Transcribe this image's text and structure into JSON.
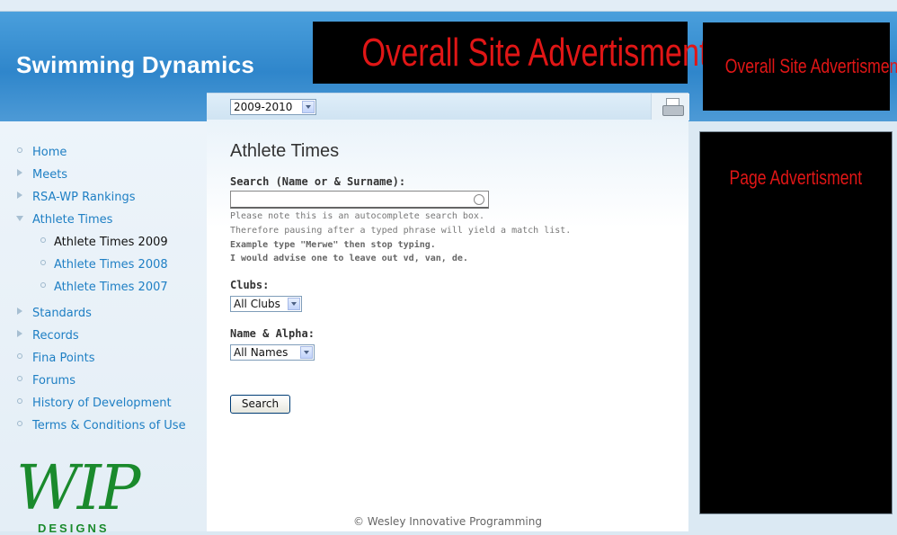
{
  "site": {
    "title": "Swimming Dynamics"
  },
  "ads": {
    "banner": "Overall Site Advertisment",
    "right_top": "Overall Site Advertisment",
    "page": "Page Advertisment"
  },
  "season": {
    "selected": "2009-2010"
  },
  "nav": {
    "items": [
      {
        "label": "Home"
      },
      {
        "label": "Meets"
      },
      {
        "label": "RSA-WP Rankings"
      },
      {
        "label": "Athlete Times"
      },
      {
        "label": "Athlete Times 2009"
      },
      {
        "label": "Athlete Times 2008"
      },
      {
        "label": "Athlete Times 2007"
      },
      {
        "label": "Standards"
      },
      {
        "label": "Records"
      },
      {
        "label": "Fina Points"
      },
      {
        "label": "Forums"
      },
      {
        "label": "History of Development"
      },
      {
        "label": "Terms & Conditions of Use"
      }
    ]
  },
  "logo": {
    "text": "WIP",
    "subtext": "DESIGNS"
  },
  "main": {
    "title": "Athlete Times",
    "search_label": "Search (Name or & Surname):",
    "search_value": "",
    "note1": "Please note this is an autocomplete search box.",
    "note2": "Therefore pausing after a typed phrase will yield a match list.",
    "note3": "Example type \"Merwe\" then stop typing.",
    "note4": "I would advise one to leave out vd, van, de.",
    "clubs_label": "Clubs:",
    "clubs_selected": "All Clubs",
    "names_label": "Name & Alpha:",
    "names_selected": "All Names",
    "search_button": "Search"
  },
  "footer": {
    "text": "© Wesley Innovative Programming"
  },
  "colors": {
    "header": "#2f86cb",
    "link": "#1e7fc4",
    "ad_text": "#e01616",
    "logo": "#1a8a2c"
  }
}
